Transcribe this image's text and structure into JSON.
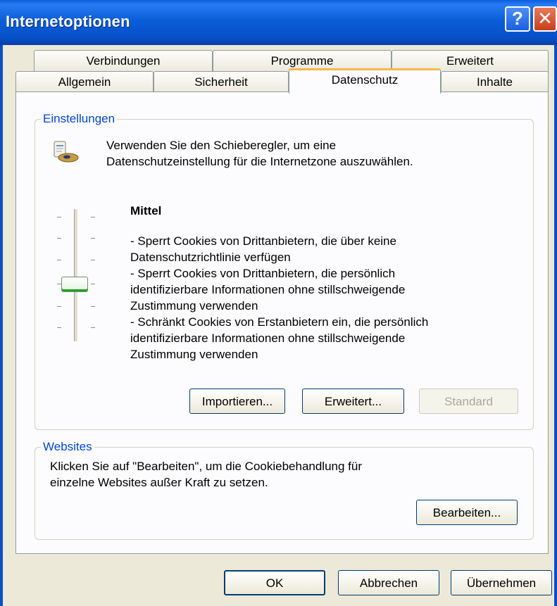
{
  "window": {
    "title": "Internetoptionen",
    "help_glyph": "?",
    "close_glyph": "✕"
  },
  "tabs": {
    "row1": [
      "Verbindungen",
      "Programme",
      "Erweitert"
    ],
    "row2": [
      "Allgemein",
      "Sicherheit",
      "Datenschutz",
      "Inhalte"
    ],
    "active": "Datenschutz"
  },
  "einstellungen": {
    "title": "Einstellungen",
    "intro_line1": "Verwenden Sie den Schieberegler, um eine",
    "intro_line2": "Datenschutzeinstellung für die Internetzone auszuwählen.",
    "level_name": "Mittel",
    "desc_lines": [
      "- Sperrt Cookies von Drittanbietern, die über keine",
      "Datenschutzrichtlinie verfügen",
      "- Sperrt Cookies von Drittanbietern, die persönlich",
      "identifizierbare Informationen ohne stillschweigende",
      "Zustimmung verwenden",
      "- Schränkt Cookies von Erstanbietern ein, die persönlich",
      "identifizierbare Informationen ohne stillschweigende",
      "Zustimmung verwenden"
    ],
    "slider_level": "4 of 6 from top",
    "buttons": {
      "import": "Importieren...",
      "advanced": "Erweitert...",
      "default": "Standard"
    },
    "icon": "privacy-settings-icon"
  },
  "websites": {
    "title": "Websites",
    "line1": "Klicken Sie auf \"Bearbeiten\", um die Cookiebehandlung für",
    "line2": "einzelne Websites außer Kraft zu setzen.",
    "edit_button": "Bearbeiten..."
  },
  "footer": {
    "ok": "OK",
    "cancel": "Abbrechen",
    "apply": "Übernehmen"
  },
  "colors": {
    "titlebar": "#0a5fd9",
    "active_tab_accent": "#f7b84a",
    "group_title": "#0046d5",
    "face": "#ece9d8"
  }
}
